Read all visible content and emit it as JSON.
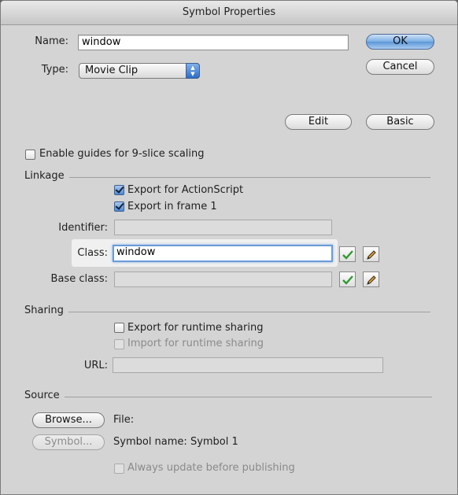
{
  "window": {
    "title": "Symbol Properties"
  },
  "form": {
    "name_label": "Name:",
    "name_value": "window",
    "type_label": "Type:",
    "type_value": "Movie Clip"
  },
  "buttons": {
    "ok": "OK",
    "cancel": "Cancel",
    "edit": "Edit",
    "basic": "Basic",
    "browse": "Browse...",
    "symbol": "Symbol..."
  },
  "nine_slice": {
    "label": "Enable guides for 9-slice scaling",
    "checked": false
  },
  "linkage": {
    "title": "Linkage",
    "export_actionscript": {
      "label": "Export for ActionScript",
      "checked": true
    },
    "export_frame1": {
      "label": "Export in frame 1",
      "checked": true
    },
    "identifier_label": "Identifier:",
    "identifier_value": "",
    "class_label": "Class:",
    "class_value": "window",
    "base_class_label": "Base class:",
    "base_class_value": ""
  },
  "sharing": {
    "title": "Sharing",
    "export_runtime": {
      "label": "Export for runtime sharing",
      "checked": false
    },
    "import_runtime": {
      "label": "Import for runtime sharing",
      "checked": false
    },
    "url_label": "URL:",
    "url_value": ""
  },
  "source": {
    "title": "Source",
    "file_label": "File:",
    "symbol_name_label": "Symbol name: Symbol 1",
    "always_update": {
      "label": "Always update before publishing",
      "checked": false
    }
  },
  "icons": {
    "validate": "checkmark-icon",
    "edit": "pencil-icon"
  },
  "colors": {
    "dialog_bg": "#d4d4d4",
    "accent": "#5b96d7",
    "check_green": "#2f9a2f"
  }
}
